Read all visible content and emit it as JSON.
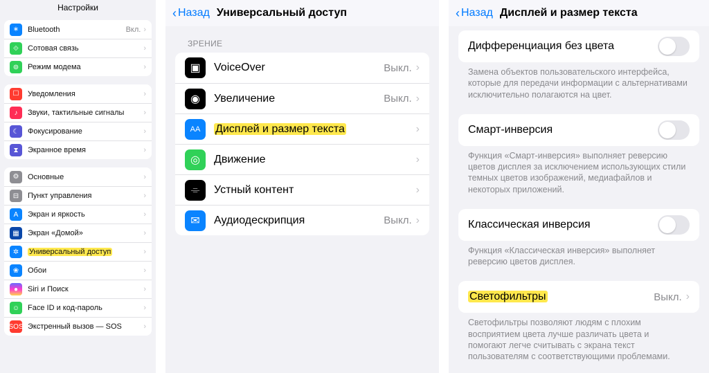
{
  "panel1": {
    "title": "Настройки",
    "groups": [
      [
        {
          "icon": "bluetooth-icon",
          "iconCls": "i-blue",
          "glyph": "∗",
          "label": "Bluetooth",
          "detail": "Вкл."
        },
        {
          "icon": "cellular-icon",
          "iconCls": "i-green",
          "glyph": "⟐",
          "label": "Сотовая связь"
        },
        {
          "icon": "hotspot-icon",
          "iconCls": "i-green",
          "glyph": "⊚",
          "label": "Режим модема"
        }
      ],
      [
        {
          "icon": "notifications-icon",
          "iconCls": "i-red",
          "glyph": "☐",
          "label": "Уведомления"
        },
        {
          "icon": "sounds-icon",
          "iconCls": "i-pink",
          "glyph": "♪",
          "label": "Звуки, тактильные сигналы"
        },
        {
          "icon": "focus-icon",
          "iconCls": "i-indigo",
          "glyph": "☾",
          "label": "Фокусирование"
        },
        {
          "icon": "screentime-icon",
          "iconCls": "i-indigo",
          "glyph": "⧗",
          "label": "Экранное время"
        }
      ],
      [
        {
          "icon": "general-icon",
          "iconCls": "i-gray",
          "glyph": "⚙",
          "label": "Основные"
        },
        {
          "icon": "control-center-icon",
          "iconCls": "i-gray",
          "glyph": "⊟",
          "label": "Пункт управления"
        },
        {
          "icon": "display-icon",
          "iconCls": "i-blue",
          "glyph": "A",
          "label": "Экран и яркость"
        },
        {
          "icon": "home-screen-icon",
          "iconCls": "i-dblue",
          "glyph": "▦",
          "label": "Экран «Домой»"
        },
        {
          "icon": "accessibility-icon",
          "iconCls": "i-blue",
          "glyph": "✲",
          "label": "Универсальный доступ",
          "highlight": true
        },
        {
          "icon": "wallpaper-icon",
          "iconCls": "i-blue",
          "glyph": "❀",
          "label": "Обои"
        },
        {
          "icon": "siri-icon",
          "iconCls": "i-grad",
          "glyph": "●",
          "label": "Siri и Поиск"
        },
        {
          "icon": "faceid-icon",
          "iconCls": "i-green",
          "glyph": "☺",
          "label": "Face ID и код-пароль"
        },
        {
          "icon": "sos-icon",
          "iconCls": "i-red",
          "glyph": "SOS",
          "label": "Экстренный вызов — SOS"
        }
      ]
    ]
  },
  "panel2": {
    "back": "Назад",
    "title": "Универсальный доступ",
    "section": "ЗРЕНИЕ",
    "items": [
      {
        "icon": "voiceover-icon",
        "iconCls": "i-black",
        "glyph": "▣",
        "label": "VoiceOver",
        "detail": "Выкл."
      },
      {
        "icon": "zoom-icon",
        "iconCls": "i-black",
        "glyph": "◉",
        "label": "Увеличение",
        "detail": "Выкл."
      },
      {
        "icon": "text-size-icon",
        "iconCls": "i-blue",
        "glyph": "AA",
        "label": "Дисплей и размер текста",
        "highlight": true
      },
      {
        "icon": "motion-icon",
        "iconCls": "i-green",
        "glyph": "◎",
        "label": "Движение"
      },
      {
        "icon": "spoken-content-icon",
        "iconCls": "i-black",
        "glyph": "⌯",
        "label": "Устный контент"
      },
      {
        "icon": "audiodesc-icon",
        "iconCls": "i-blue",
        "glyph": "✉",
        "label": "Аудиодескрипция",
        "detail": "Выкл."
      }
    ]
  },
  "panel3": {
    "back": "Назад",
    "title": "Дисплей и размер текста",
    "items": [
      {
        "kind": "toggle",
        "label": "Дифференциация без цвета",
        "desc": "Замена объектов пользовательского интерфейса, которые для передачи информации с альтернативами исключительно полагаются на цвет."
      },
      {
        "kind": "toggle",
        "label": "Смарт-инверсия",
        "desc": "Функция «Смарт-инверсия» выполняет реверсию цветов дисплея за исключением использующих стили темных цветов изображений, медиафайлов и некоторых приложений."
      },
      {
        "kind": "toggle",
        "label": "Классическая инверсия",
        "desc": "Функция «Классическая инверсия» выполняет реверсию цветов дисплея."
      },
      {
        "kind": "link",
        "label": "Светофильтры",
        "detail": "Выкл.",
        "highlight": true,
        "desc": "Светофильтры позволяют людям с плохим восприятием цвета лучше различать цвета и помогают легче считывать с экрана текст пользователям с соответствующими проблемами."
      }
    ]
  }
}
